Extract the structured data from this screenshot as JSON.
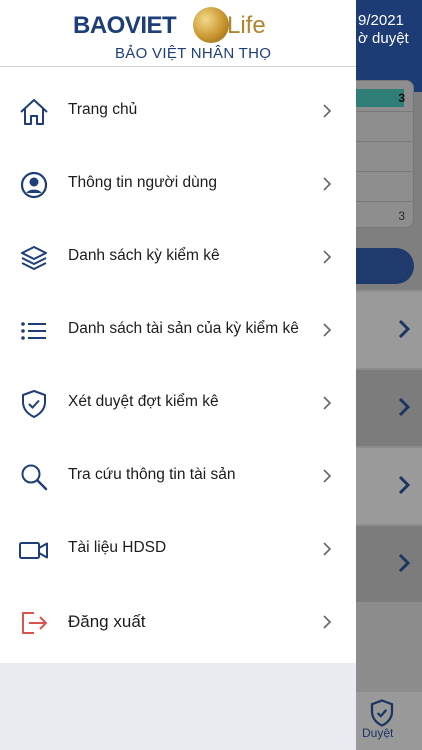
{
  "background": {
    "header_line1": "9/2021",
    "header_line2": "ờ duyệt",
    "card_value_top": "3",
    "card_value_bottom": "3",
    "bottom_tab_label": "Duyệt"
  },
  "drawer": {
    "logo": {
      "brand": "BAOVIET",
      "suffix": "Life",
      "subtitle": "BẢO VIỆT NHÂN THỌ"
    },
    "menu": [
      {
        "label": "Trang chủ",
        "icon": "home-icon"
      },
      {
        "label": "Thông tin người dùng",
        "icon": "user-icon"
      },
      {
        "label": "Danh sách kỳ kiểm kê",
        "icon": "layers-icon"
      },
      {
        "label": "Danh sách tài sản của kỳ kiểm kê",
        "icon": "list-icon"
      },
      {
        "label": "Xét duyệt đợt kiểm kê",
        "icon": "shield-check-icon"
      },
      {
        "label": "Tra cứu thông tin tài sản",
        "icon": "search-icon"
      },
      {
        "label": "Tài liệu HDSD",
        "icon": "video-icon"
      },
      {
        "label": "Đăng xuất",
        "icon": "logout-icon"
      }
    ]
  },
  "colors": {
    "brand_blue": "#1e3e79",
    "brand_gold": "#b0862c",
    "logout_red": "#d9534f"
  }
}
